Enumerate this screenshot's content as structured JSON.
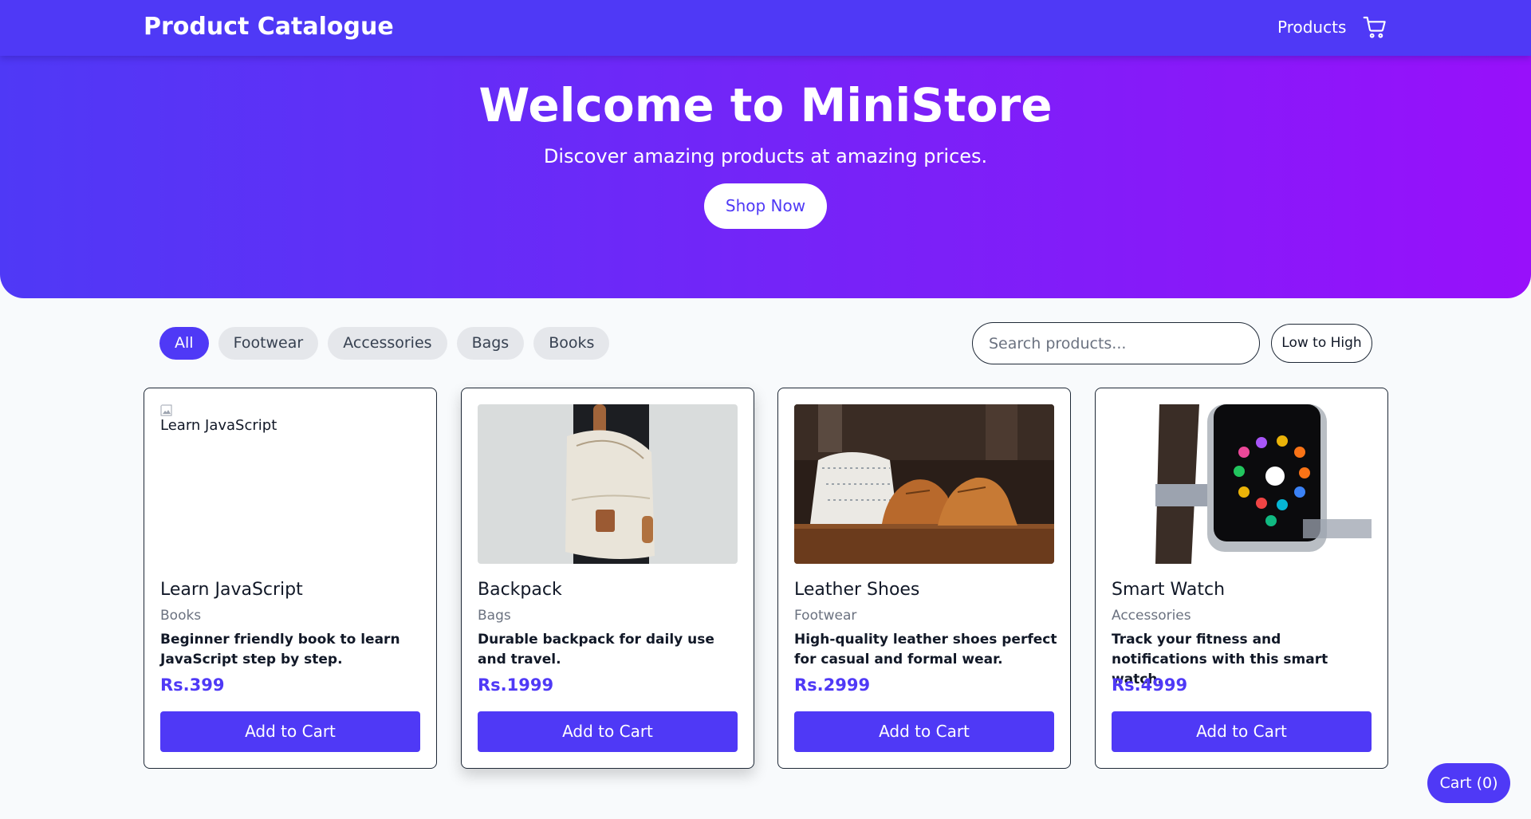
{
  "header": {
    "brand": "Product Catalogue",
    "nav_products": "Products",
    "cart_icon": "cart-icon"
  },
  "hero": {
    "title": "Welcome to MiniStore",
    "subtitle": "Discover amazing products at amazing prices.",
    "cta": "Shop Now"
  },
  "filters": {
    "categories": [
      "All",
      "Footwear",
      "Accessories",
      "Bags",
      "Books"
    ],
    "active": "All",
    "search_placeholder": "Search products...",
    "sort_label": "Low to High"
  },
  "products": [
    {
      "name": "Learn JavaScript",
      "category": "Books",
      "description": "Beginner friendly book to learn JavaScript step by step.",
      "price": "Rs.399",
      "button": "Add to Cart",
      "image_alt": "Learn JavaScript",
      "image_broken": true
    },
    {
      "name": "Backpack",
      "category": "Bags",
      "description": "Durable backpack for daily use and travel.",
      "price": "Rs.1999",
      "button": "Add to Cart"
    },
    {
      "name": "Leather Shoes",
      "category": "Footwear",
      "description": "High-quality leather shoes perfect for casual and formal wear.",
      "price": "Rs.2999",
      "button": "Add to Cart"
    },
    {
      "name": "Smart Watch",
      "category": "Accessories",
      "description": "Track your fitness and notifications with this smart watch.",
      "price": "Rs.4999",
      "button": "Add to Cart"
    }
  ],
  "cart_button": "Cart (0)",
  "colors": {
    "primary": "#4f39f6",
    "gradient_end": "#9810fa",
    "page_bg": "#f8fafc"
  }
}
